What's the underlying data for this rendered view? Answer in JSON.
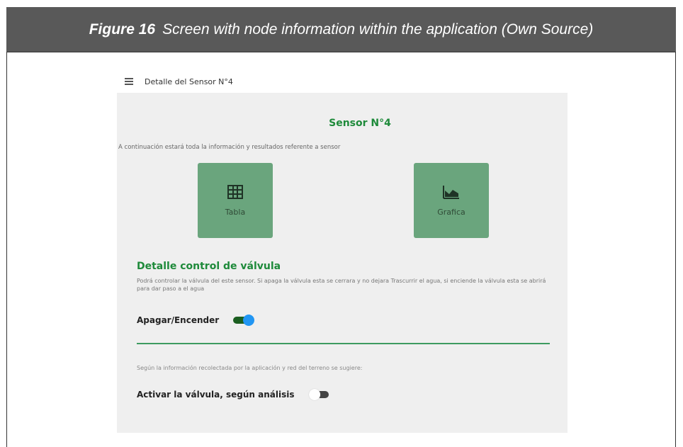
{
  "caption": {
    "figure_number": "Figure 16",
    "text": "Screen with node information within the application (Own Source)"
  },
  "app": {
    "header_title": "Detalle del Sensor N°4",
    "sensor_title": "Sensor N°4",
    "intro": "A continuación estará toda la información y resultados referente a sensor",
    "tiles": [
      {
        "label": "Tabla",
        "icon": "table-icon"
      },
      {
        "label": "Grafica",
        "icon": "area-chart-icon"
      }
    ],
    "valve": {
      "title": "Detalle control de válvula",
      "description": "Podrá controlar la válvula del este sensor. Si apaga la válvula esta se cerrara y no dejara Trascurrir el agua, si enciende la válvula esta se abrirá para dar paso a el agua",
      "toggle_label": "Apagar/Encender",
      "toggle_on": true
    },
    "suggestion": "Según la información recolectada por la aplicación y red del terreno se sugiere:",
    "analysis_toggle_label": "Activar la válvula, según análisis",
    "analysis_toggle_on": false
  },
  "colors": {
    "caption_bg": "#595959",
    "accent_green": "#1e8a3a",
    "tile_green": "#6aa57d",
    "toggle_knob_on": "#2196f3"
  }
}
